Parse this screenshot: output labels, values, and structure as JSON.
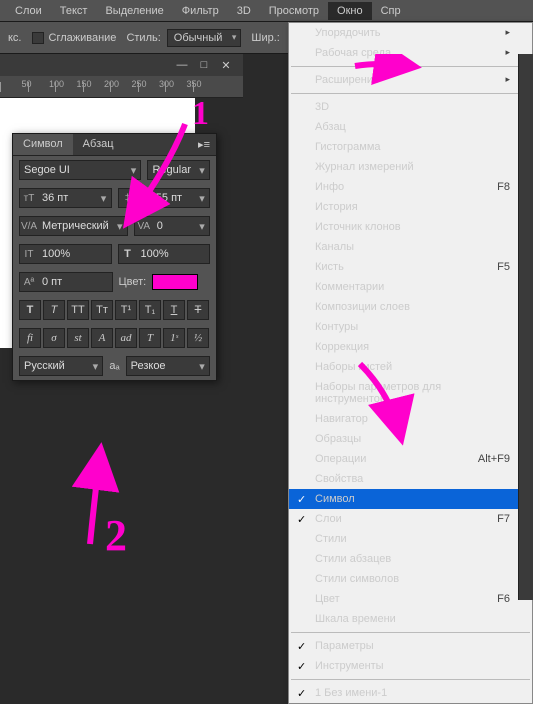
{
  "menubar": {
    "items": [
      "Слои",
      "Текст",
      "Выделение",
      "Фильтр",
      "3D",
      "Просмотр",
      "Окно",
      "Спр"
    ],
    "activeIndex": 6
  },
  "optbar": {
    "smoothing": "Сглаживание",
    "styleLabel": "Стиль:",
    "styleValue": "Обычный",
    "widthLabel": "Шир.:"
  },
  "ruler": {
    "ticks": [
      0,
      50,
      100,
      150,
      200,
      250,
      300,
      350
    ]
  },
  "docbar": {
    "icons": [
      "min",
      "max",
      "close"
    ]
  },
  "charPanel": {
    "tabs": [
      "Символ",
      "Абзац"
    ],
    "font": "Segoe UI",
    "fontStyle": "Regular",
    "size": "36 пт",
    "leading": "25,55 пт",
    "tracking": "Метрический",
    "kerning": "0",
    "vscale": "100%",
    "hscale": "100%",
    "baseline": "0 пт",
    "colorLabel": "Цвет:",
    "lang": "Русский",
    "aa": "Резкое"
  },
  "windowMenu": {
    "arrange": "Упорядочить",
    "workspace": "Рабочая среда",
    "extensions": "Расширения",
    "items": [
      {
        "t": "3D"
      },
      {
        "t": "Абзац"
      },
      {
        "t": "Гистограмма"
      },
      {
        "t": "Журнал измерений"
      },
      {
        "t": "Инфо",
        "s": "F8"
      },
      {
        "t": "История"
      },
      {
        "t": "Источник клонов"
      },
      {
        "t": "Каналы"
      },
      {
        "t": "Кисть",
        "s": "F5"
      },
      {
        "t": "Комментарии"
      },
      {
        "t": "Композиции слоев"
      },
      {
        "t": "Контуры"
      },
      {
        "t": "Коррекция"
      },
      {
        "t": "Наборы кистей"
      },
      {
        "t": "Наборы параметров для инструментов"
      },
      {
        "t": "Навигатор"
      },
      {
        "t": "Образцы"
      },
      {
        "t": "Операции",
        "s": "Alt+F9"
      },
      {
        "t": "Свойства"
      },
      {
        "t": "Символ",
        "c": true,
        "hl": true
      },
      {
        "t": "Слои",
        "c": true,
        "s": "F7"
      },
      {
        "t": "Стили"
      },
      {
        "t": "Стили абзацев"
      },
      {
        "t": "Стили символов"
      },
      {
        "t": "Цвет",
        "s": "F6"
      },
      {
        "t": "Шкала времени"
      }
    ],
    "params": "Параметры",
    "tools": "Инструменты",
    "doc": "1 Без имени-1"
  },
  "annotations": {
    "one": "1",
    "two": "2"
  }
}
